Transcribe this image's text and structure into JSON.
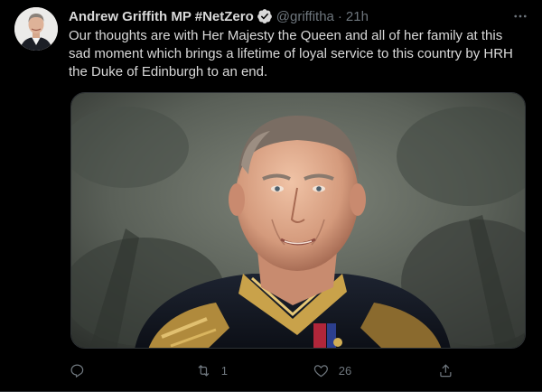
{
  "tweet": {
    "author": {
      "display_name": "Andrew Griffith MP #NetZero",
      "handle": "@griffitha",
      "verified": true,
      "avatar_icon": "profile-photo"
    },
    "separator": "·",
    "time": "21h",
    "text": "Our thoughts are with Her Majesty the Queen and all of her family at this sad moment which brings a lifetime of loyal service to this country by HRH the Duke of Edinburgh to an end.",
    "media": {
      "kind": "portrait-photo",
      "subject": "Duke of Edinburgh in military dress uniform"
    },
    "actions": {
      "reply": {
        "icon": "reply-icon",
        "count": ""
      },
      "retweet": {
        "icon": "retweet-icon",
        "count": "1"
      },
      "like": {
        "icon": "heart-icon",
        "count": "26"
      },
      "share": {
        "icon": "share-icon",
        "count": ""
      }
    }
  },
  "colors": {
    "background": "#000000",
    "text_primary": "#d9d9d9",
    "text_secondary": "#6e767d",
    "verified_badge": "#d9d9d9",
    "divider": "#2f3336"
  }
}
